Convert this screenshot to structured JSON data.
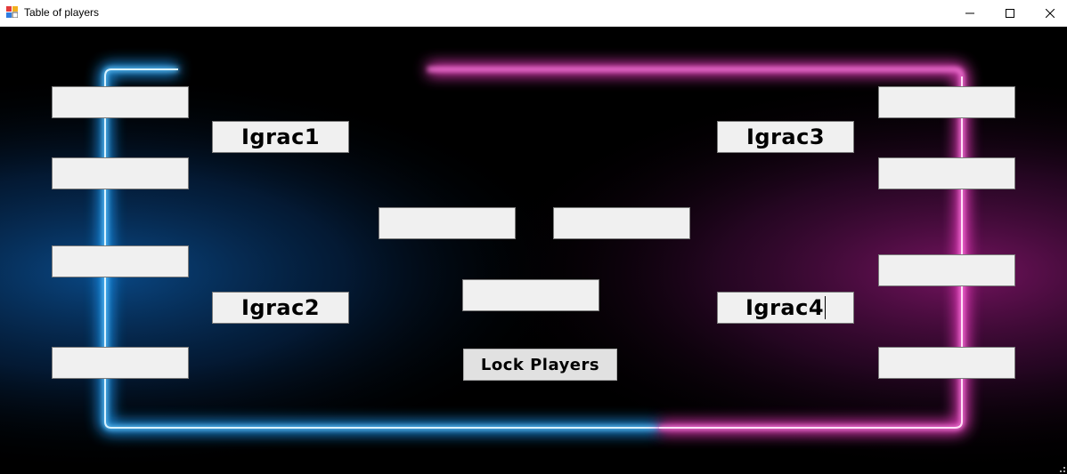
{
  "window": {
    "title": "Table of players",
    "controls": [
      "minimize-icon",
      "maximize-icon",
      "close-icon"
    ]
  },
  "colors": {
    "neon_blue": "#1ea0ff",
    "neon_pink": "#ff4fd8",
    "slot_fill": "#f0f0f0"
  },
  "bracket": {
    "left_outer": [
      "",
      "",
      "",
      ""
    ],
    "left_semis": [
      "Igrac1",
      "Igrac2"
    ],
    "finals": [
      "",
      ""
    ],
    "winner": "",
    "right_semis": [
      "Igrac3",
      "Igrac4"
    ],
    "right_outer": [
      "",
      "",
      "",
      ""
    ]
  },
  "actions": {
    "lock_label": "Lock Players"
  }
}
